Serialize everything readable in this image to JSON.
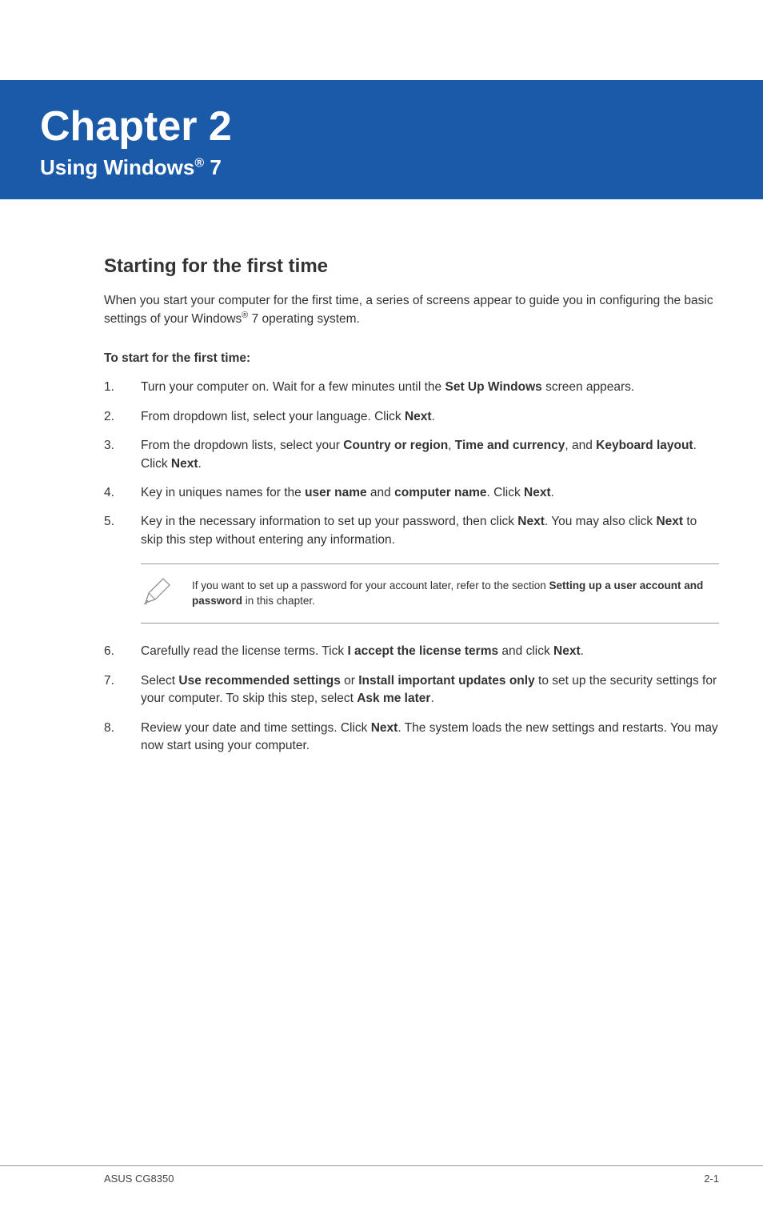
{
  "banner": {
    "chapter_label": "Chapter 2",
    "subtitle_prefix": "Using Windows",
    "subtitle_reg": "®",
    "subtitle_suffix": " 7"
  },
  "section": {
    "heading": "Starting for the first time",
    "intro_part1": "When you start your computer for the first time, a series of screens appear to guide you in configuring the basic settings of your Windows",
    "intro_reg": "®",
    "intro_part2": " 7 operating system.",
    "subheading": "To start for the first time:"
  },
  "steps": {
    "s1_a": "Turn your computer on. Wait for a few minutes until the ",
    "s1_b": "Set Up Windows",
    "s1_c": " screen appears.",
    "s2_a": "From dropdown list, select your language. Click ",
    "s2_b": "Next",
    "s2_c": ".",
    "s3_a": "From the dropdown lists, select your ",
    "s3_b": "Country or region",
    "s3_c": ", ",
    "s3_d": "Time and currency",
    "s3_e": ", and ",
    "s3_f": "Keyboard layout",
    "s3_g": ". Click ",
    "s3_h": "Next",
    "s3_i": ".",
    "s4_a": "Key in uniques names for the ",
    "s4_b": "user name",
    "s4_c": " and ",
    "s4_d": "computer name",
    "s4_e": ". Click ",
    "s4_f": "Next",
    "s4_g": ".",
    "s5_a": "Key in the necessary information to set up your password, then click ",
    "s5_b": "Next",
    "s5_c": ". You may also click ",
    "s5_d": "Next",
    "s5_e": " to skip this step without entering any information.",
    "s6_a": "Carefully read the license terms. Tick ",
    "s6_b": "I accept the license terms",
    "s6_c": " and click ",
    "s6_d": "Next",
    "s6_e": ".",
    "s7_a": "Select ",
    "s7_b": "Use recommended settings",
    "s7_c": " or ",
    "s7_d": "Install important updates only",
    "s7_e": " to set up the security settings for your computer. To skip this step, select ",
    "s7_f": "Ask me later",
    "s7_g": ".",
    "s8_a": "Review your date and time settings. Click ",
    "s8_b": "Next",
    "s8_c": ". The system loads the new settings and restarts. You may now start using your computer."
  },
  "note": {
    "text_a": "If you want to set up a password for your account later, refer to the section ",
    "text_b": "Setting up a user account and password",
    "text_c": " in this chapter."
  },
  "footer": {
    "left": "ASUS CG8350",
    "right": "2-1"
  }
}
